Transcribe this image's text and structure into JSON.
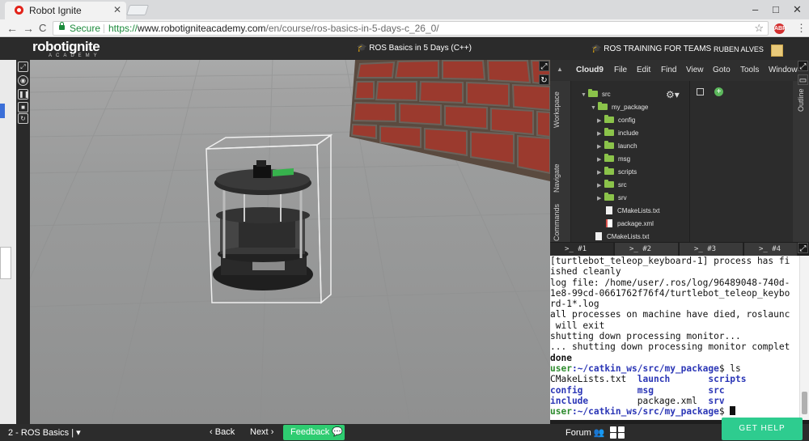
{
  "browser": {
    "tab_title": "Robot Ignite",
    "tab_close": "✕",
    "min": "–",
    "max": "□",
    "close": "✕",
    "back": "←",
    "forward": "→",
    "reload": "C",
    "secure_label": "Secure",
    "url_scheme": "https://",
    "url_host": "www.robotigniteacademy.com",
    "url_path": "/en/course/ros-basics-in-5-days-c_26_0/",
    "star": "☆",
    "ext_badge": "ABP",
    "kebab": "⋮"
  },
  "site": {
    "logo_main": "robotignite",
    "logo_sub": "ACADEMY",
    "course_title": "ROS Basics in 5 Days (C++)",
    "teams_link": "ROS TRAINING FOR TEAMS",
    "username": "RUBEN ALVES",
    "hat_icon": "🎓"
  },
  "ide": {
    "menu": [
      "Cloud9",
      "File",
      "Edit",
      "Find",
      "View",
      "Goto",
      "Tools",
      "Window"
    ],
    "side_tabs": [
      "Workspace",
      "Navigate",
      "Commands"
    ],
    "right_tab": "Outline",
    "tree": [
      {
        "label": "src",
        "type": "folder",
        "depth": 0,
        "open": true
      },
      {
        "label": "my_package",
        "type": "folder",
        "depth": 1,
        "open": true
      },
      {
        "label": "config",
        "type": "folder",
        "depth": 2
      },
      {
        "label": "include",
        "type": "folder",
        "depth": 2
      },
      {
        "label": "launch",
        "type": "folder",
        "depth": 2
      },
      {
        "label": "msg",
        "type": "folder",
        "depth": 2
      },
      {
        "label": "scripts",
        "type": "folder",
        "depth": 2
      },
      {
        "label": "src",
        "type": "folder",
        "depth": 2
      },
      {
        "label": "srv",
        "type": "folder",
        "depth": 2
      },
      {
        "label": "CMakeLists.txt",
        "type": "file",
        "depth": 2
      },
      {
        "label": "package.xml",
        "type": "xml",
        "depth": 2
      },
      {
        "label": "CMakeLists.txt",
        "type": "file",
        "depth": 1
      }
    ]
  },
  "terminal": {
    "tabs": [
      ">_ #1",
      ">_ #2",
      ">_ #3",
      ">_ #4"
    ],
    "lines": [
      "[turtlebot_teleop_keyboard-1] process has fi",
      "ished cleanly",
      "log file: /home/user/.ros/log/96489048-740d-",
      "1e8-99cd-0661762f76f4/turtlebot_teleop_keybo",
      "rd-1*.log",
      "all processes on machine have died, roslaunc",
      " will exit",
      "shutting down processing monitor...",
      "... shutting down processing monitor complet",
      "done"
    ],
    "prompt_user": "user",
    "prompt_path": ":~/catkin_ws/src/my_package",
    "cmd1": "$ ls",
    "ls": [
      [
        "CMakeLists.txt",
        "launch",
        "scripts"
      ],
      [
        "config",
        "msg",
        "src"
      ],
      [
        "include",
        "package.xml",
        "srv"
      ]
    ],
    "cmd2": "$ "
  },
  "bottom": {
    "unit_select": "2 - ROS Basics |",
    "back": "Back",
    "next": "Next",
    "feedback": "Feedback",
    "forum": "Forum",
    "get_help": "GET HELP"
  },
  "colors": {
    "folder": "#8bc34a",
    "prompt_green": "#2e8b2e",
    "dir_blue": "#2b36b6",
    "feedback_green": "#2ecc71"
  }
}
